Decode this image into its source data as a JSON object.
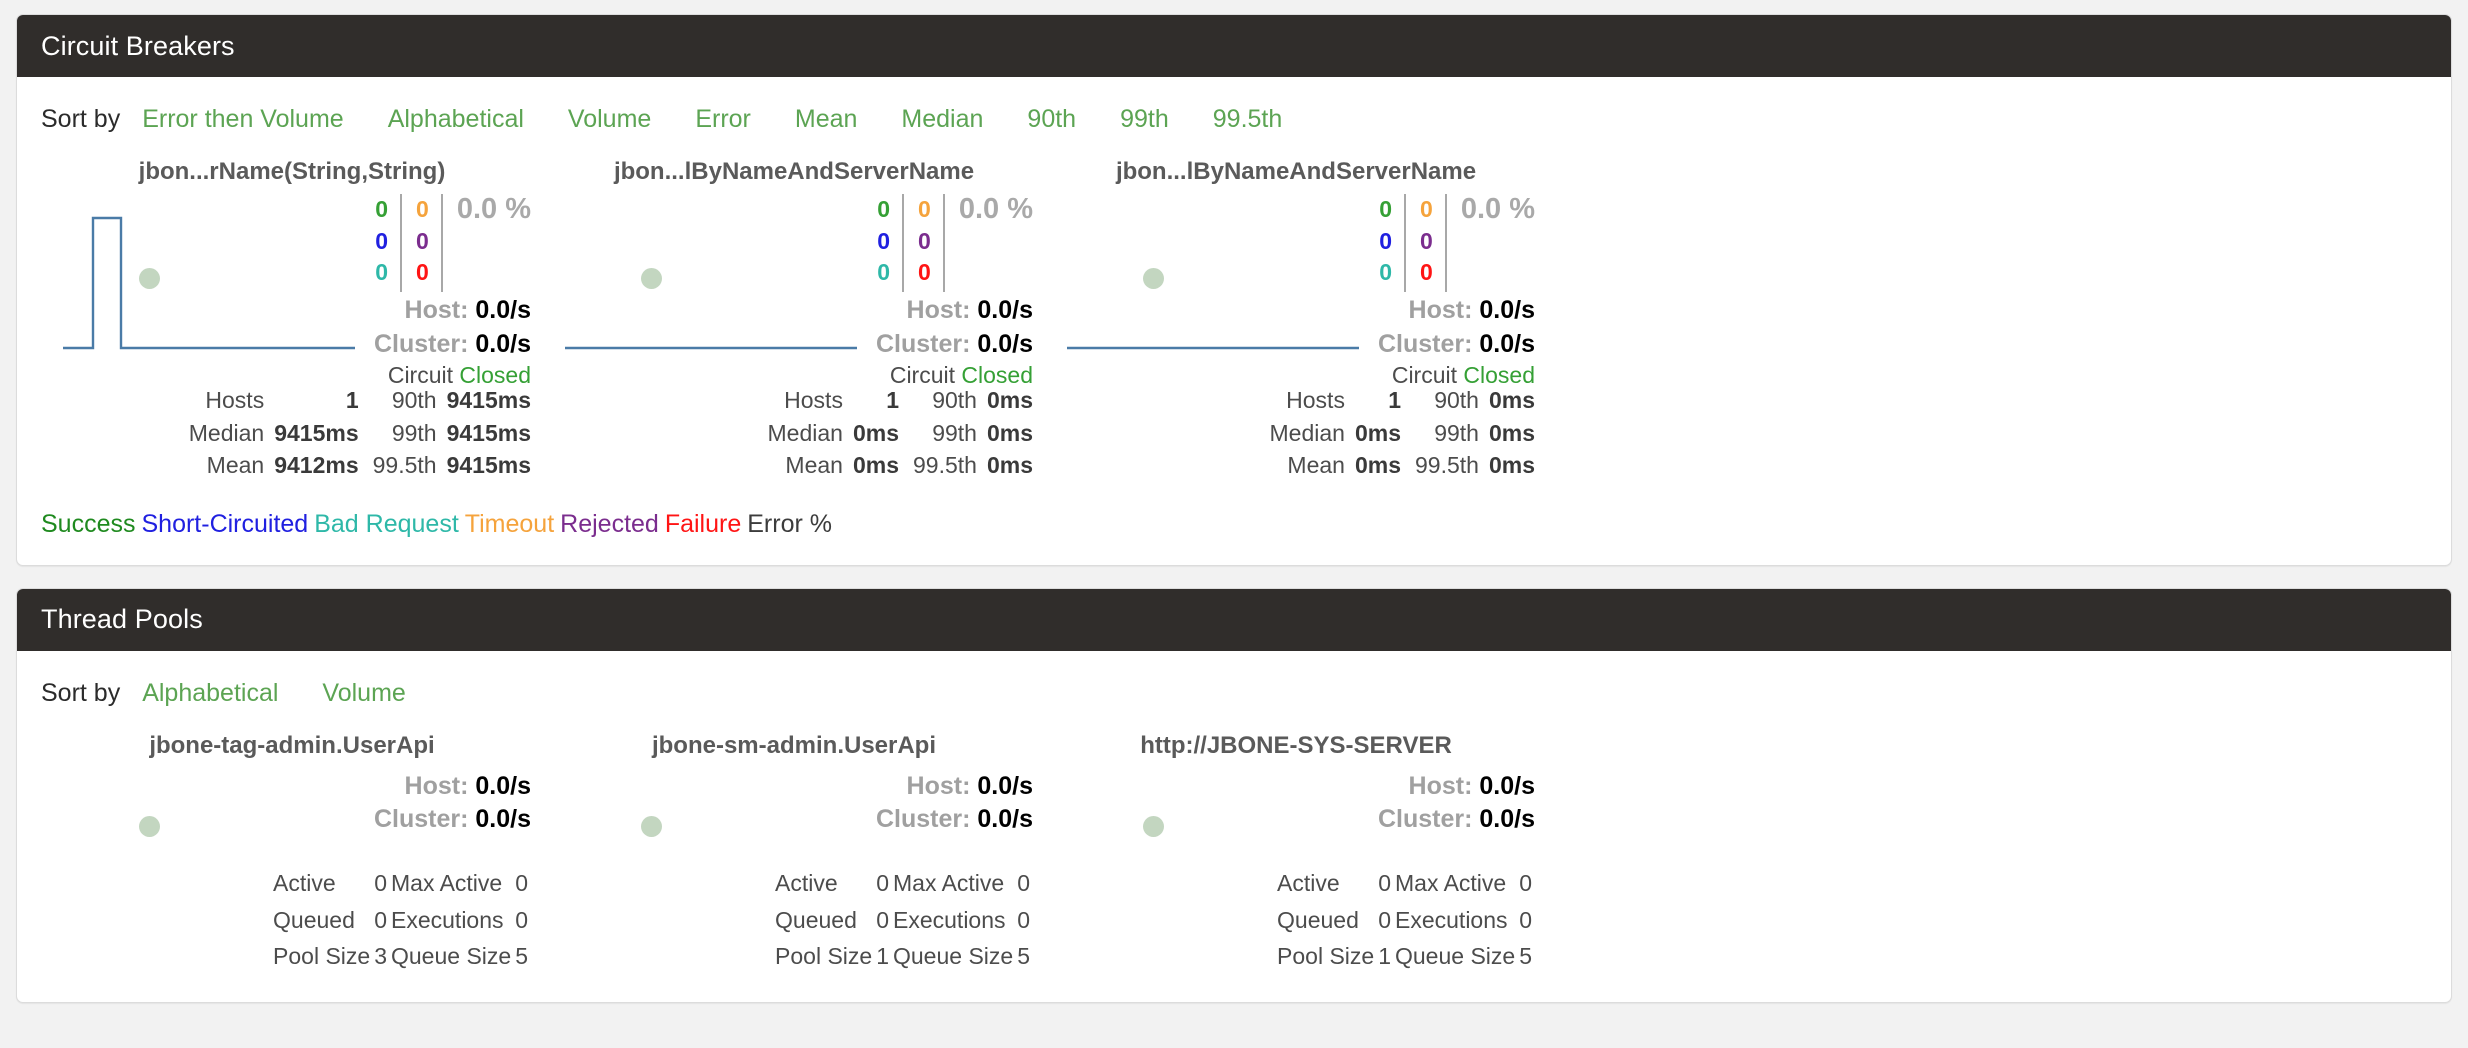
{
  "colors": {
    "green": "#35a035",
    "sort_link": "#5ca453",
    "blue": "#2020e0",
    "teal": "#2eb8a8",
    "orange": "#f5a33c",
    "purple": "#7b2d8e",
    "red": "#ff1414",
    "grey": "#a9a9a9",
    "header_bg": "#302d2b",
    "spark_line": "#4a7ba7",
    "dot": "#c3d6c0"
  },
  "circuit_breakers": {
    "title": "Circuit Breakers",
    "sort_label": "Sort by",
    "sort_links": [
      "Error then Volume",
      "Alphabetical",
      "Volume",
      "Error",
      "Mean",
      "Median",
      "90th",
      "99th",
      "99.5th"
    ],
    "legend": [
      {
        "label": "Success",
        "color": "#1f8a1f"
      },
      {
        "label": "Short-Circuited",
        "color": "#2020e0"
      },
      {
        "label": "Bad Request",
        "color": "#2eb8a8"
      },
      {
        "label": "Timeout",
        "color": "#f5a33c"
      },
      {
        "label": "Rejected",
        "color": "#7b2d8e"
      },
      {
        "label": "Failure",
        "color": "#ff1414"
      },
      {
        "label": "Error %",
        "color": "#3c3c3c"
      }
    ],
    "cards": [
      {
        "name": "jbon...rName(String,String)",
        "counters": {
          "success": "0",
          "timeout": "0",
          "short_circuited": "0",
          "rejected": "0",
          "bad_request": "0",
          "failure": "0"
        },
        "error_pct": "0.0 %",
        "host_label": "Host:",
        "host_rate": "0.0/s",
        "cluster_label": "Cluster:",
        "cluster_rate": "0.0/s",
        "circuit_label": "Circuit",
        "circuit_state": "Closed",
        "stats_left": [
          {
            "label": "Hosts",
            "value": "1"
          },
          {
            "label": "Median",
            "value": "9415ms"
          },
          {
            "label": "Mean",
            "value": "9412ms"
          }
        ],
        "stats_right": [
          {
            "label": "90th",
            "value": "9415ms"
          },
          {
            "label": "99th",
            "value": "9415ms"
          },
          {
            "label": "99.5th",
            "value": "9415ms"
          }
        ],
        "sparkline": "spike"
      },
      {
        "name": "jbon...lByNameAndServerName",
        "counters": {
          "success": "0",
          "timeout": "0",
          "short_circuited": "0",
          "rejected": "0",
          "bad_request": "0",
          "failure": "0"
        },
        "error_pct": "0.0 %",
        "host_label": "Host:",
        "host_rate": "0.0/s",
        "cluster_label": "Cluster:",
        "cluster_rate": "0.0/s",
        "circuit_label": "Circuit",
        "circuit_state": "Closed",
        "stats_left": [
          {
            "label": "Hosts",
            "value": "1"
          },
          {
            "label": "Median",
            "value": "0ms"
          },
          {
            "label": "Mean",
            "value": "0ms"
          }
        ],
        "stats_right": [
          {
            "label": "90th",
            "value": "0ms"
          },
          {
            "label": "99th",
            "value": "0ms"
          },
          {
            "label": "99.5th",
            "value": "0ms"
          }
        ],
        "sparkline": "flat"
      },
      {
        "name": "jbon...lByNameAndServerName",
        "counters": {
          "success": "0",
          "timeout": "0",
          "short_circuited": "0",
          "rejected": "0",
          "bad_request": "0",
          "failure": "0"
        },
        "error_pct": "0.0 %",
        "host_label": "Host:",
        "host_rate": "0.0/s",
        "cluster_label": "Cluster:",
        "cluster_rate": "0.0/s",
        "circuit_label": "Circuit",
        "circuit_state": "Closed",
        "stats_left": [
          {
            "label": "Hosts",
            "value": "1"
          },
          {
            "label": "Median",
            "value": "0ms"
          },
          {
            "label": "Mean",
            "value": "0ms"
          }
        ],
        "stats_right": [
          {
            "label": "90th",
            "value": "0ms"
          },
          {
            "label": "99th",
            "value": "0ms"
          },
          {
            "label": "99.5th",
            "value": "0ms"
          }
        ],
        "sparkline": "flat"
      }
    ]
  },
  "thread_pools": {
    "title": "Thread Pools",
    "sort_label": "Sort by",
    "sort_links": [
      "Alphabetical",
      "Volume"
    ],
    "cards": [
      {
        "name": "jbone-tag-admin.UserApi",
        "host_label": "Host:",
        "host_rate": "0.0/s",
        "cluster_label": "Cluster:",
        "cluster_rate": "0.0/s",
        "stats_left": [
          {
            "label": "Active",
            "value": "0"
          },
          {
            "label": "Queued",
            "value": "0"
          },
          {
            "label": "Pool Size",
            "value": "3"
          }
        ],
        "stats_right": [
          {
            "label": "Max Active",
            "value": "0"
          },
          {
            "label": "Executions",
            "value": "0"
          },
          {
            "label": "Queue Size",
            "value": "5"
          }
        ]
      },
      {
        "name": "jbone-sm-admin.UserApi",
        "host_label": "Host:",
        "host_rate": "0.0/s",
        "cluster_label": "Cluster:",
        "cluster_rate": "0.0/s",
        "stats_left": [
          {
            "label": "Active",
            "value": "0"
          },
          {
            "label": "Queued",
            "value": "0"
          },
          {
            "label": "Pool Size",
            "value": "1"
          }
        ],
        "stats_right": [
          {
            "label": "Max Active",
            "value": "0"
          },
          {
            "label": "Executions",
            "value": "0"
          },
          {
            "label": "Queue Size",
            "value": "5"
          }
        ]
      },
      {
        "name": "http://JBONE-SYS-SERVER",
        "host_label": "Host:",
        "host_rate": "0.0/s",
        "cluster_label": "Cluster:",
        "cluster_rate": "0.0/s",
        "stats_left": [
          {
            "label": "Active",
            "value": "0"
          },
          {
            "label": "Queued",
            "value": "0"
          },
          {
            "label": "Pool Size",
            "value": "1"
          }
        ],
        "stats_right": [
          {
            "label": "Max Active",
            "value": "0"
          },
          {
            "label": "Executions",
            "value": "0"
          },
          {
            "label": "Queue Size",
            "value": "5"
          }
        ]
      }
    ]
  }
}
